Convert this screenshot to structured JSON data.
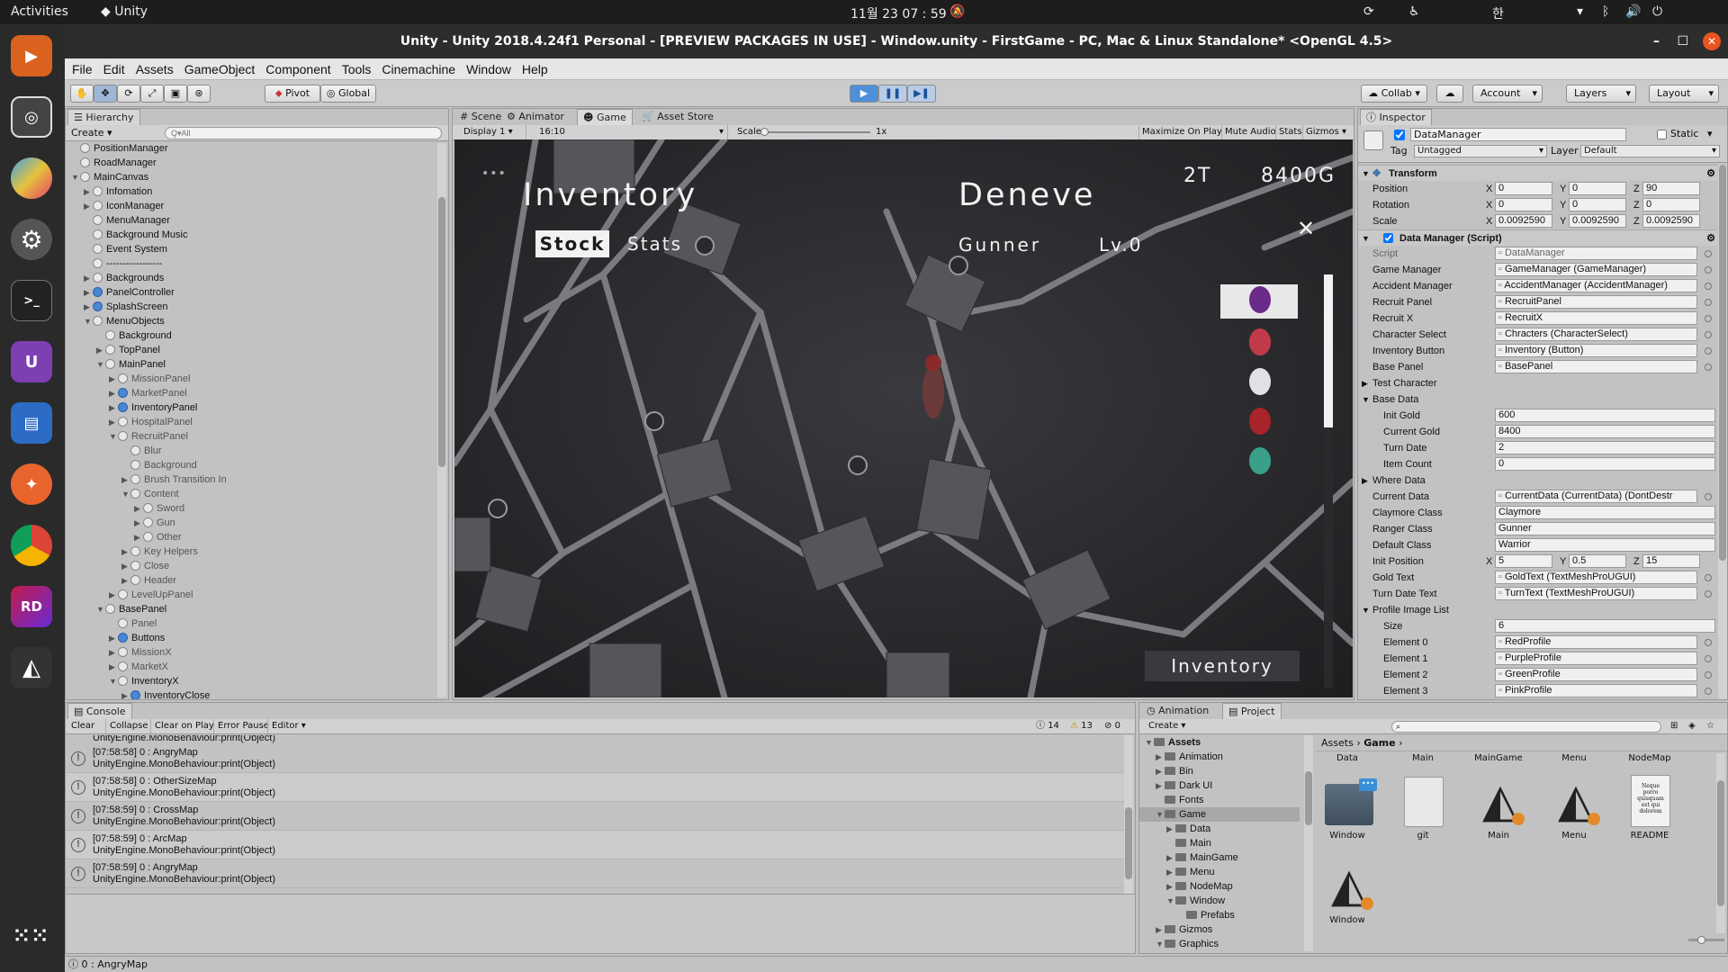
{
  "system": {
    "activities": "Activities",
    "app": "Unity",
    "clock": "11월 23  07 : 59",
    "ime": "한"
  },
  "window": {
    "title": "Unity - Unity 2018.4.24f1 Personal - [PREVIEW PACKAGES IN USE] - Window.unity - FirstGame - PC, Mac & Linux Standalone* <OpenGL 4.5>"
  },
  "menu": [
    "File",
    "Edit",
    "Assets",
    "GameObject",
    "Component",
    "Tools",
    "Cinemachine",
    "Window",
    "Help"
  ],
  "toolbar": {
    "pivot": "Pivot",
    "global": "Global",
    "collab": "Collab",
    "account": "Account",
    "layers": "Layers",
    "layout": "Layout"
  },
  "hierarchy": {
    "tab": "Hierarchy",
    "create": "Create",
    "search_placeholder": "Q▾All",
    "items": [
      {
        "label": "PositionManager",
        "indent": 0,
        "arrow": "",
        "blue": false
      },
      {
        "label": "RoadManager",
        "indent": 0,
        "arrow": "",
        "blue": false
      },
      {
        "label": "MainCanvas",
        "indent": 0,
        "arrow": "▼",
        "blue": false
      },
      {
        "label": "Infomation",
        "indent": 1,
        "arrow": "▶",
        "blue": false
      },
      {
        "label": "IconManager",
        "indent": 1,
        "arrow": "▶",
        "blue": false
      },
      {
        "label": "MenuManager",
        "indent": 1,
        "arrow": "",
        "blue": false
      },
      {
        "label": "Background Music",
        "indent": 1,
        "arrow": "",
        "blue": false
      },
      {
        "label": "Event System",
        "indent": 1,
        "arrow": "",
        "blue": false
      },
      {
        "label": "-----------------",
        "indent": 1,
        "arrow": "",
        "blue": false
      },
      {
        "label": "Backgrounds",
        "indent": 1,
        "arrow": "▶",
        "blue": false
      },
      {
        "label": "PanelController",
        "indent": 1,
        "arrow": "▶",
        "blue": true
      },
      {
        "label": "SplashScreen",
        "indent": 1,
        "arrow": "▶",
        "blue": true
      },
      {
        "label": "MenuObjects",
        "indent": 1,
        "arrow": "▼",
        "blue": false
      },
      {
        "label": "Background",
        "indent": 2,
        "arrow": "",
        "blue": false
      },
      {
        "label": "TopPanel",
        "indent": 2,
        "arrow": "▶",
        "blue": false
      },
      {
        "label": "MainPanel",
        "indent": 2,
        "arrow": "▼",
        "blue": false
      },
      {
        "label": "MissionPanel",
        "indent": 3,
        "arrow": "▶",
        "blue": false,
        "dim": true
      },
      {
        "label": "MarketPanel",
        "indent": 3,
        "arrow": "▶",
        "blue": true,
        "dim": true
      },
      {
        "label": "InventoryPanel",
        "indent": 3,
        "arrow": "▶",
        "blue": true
      },
      {
        "label": "HospitalPanel",
        "indent": 3,
        "arrow": "▶",
        "blue": false,
        "dim": true
      },
      {
        "label": "RecruitPanel",
        "indent": 3,
        "arrow": "▼",
        "blue": false,
        "dim": true
      },
      {
        "label": "Blur",
        "indent": 4,
        "arrow": "",
        "blue": false,
        "dim": true
      },
      {
        "label": "Background",
        "indent": 4,
        "arrow": "",
        "blue": false,
        "dim": true
      },
      {
        "label": "Brush Transition In",
        "indent": 4,
        "arrow": "▶",
        "blue": false,
        "dim": true
      },
      {
        "label": "Content",
        "indent": 4,
        "arrow": "▼",
        "blue": false,
        "dim": true
      },
      {
        "label": "Sword",
        "indent": 5,
        "arrow": "▶",
        "blue": false,
        "dim": true
      },
      {
        "label": "Gun",
        "indent": 5,
        "arrow": "▶",
        "blue": false,
        "dim": true
      },
      {
        "label": "Other",
        "indent": 5,
        "arrow": "▶",
        "blue": false,
        "dim": true
      },
      {
        "label": "Key Helpers",
        "indent": 4,
        "arrow": "▶",
        "blue": false,
        "dim": true
      },
      {
        "label": "Close",
        "indent": 4,
        "arrow": "▶",
        "blue": false,
        "dim": true
      },
      {
        "label": "Header",
        "indent": 4,
        "arrow": "▶",
        "blue": false,
        "dim": true
      },
      {
        "label": "LevelUpPanel",
        "indent": 3,
        "arrow": "▶",
        "blue": false,
        "dim": true
      },
      {
        "label": "BasePanel",
        "indent": 2,
        "arrow": "▼",
        "blue": false
      },
      {
        "label": "Panel",
        "indent": 3,
        "arrow": "",
        "blue": false,
        "dim": true
      },
      {
        "label": "Buttons",
        "indent": 3,
        "arrow": "▶",
        "blue": true
      },
      {
        "label": "MissionX",
        "indent": 3,
        "arrow": "▶",
        "blue": false,
        "dim": true
      },
      {
        "label": "MarketX",
        "indent": 3,
        "arrow": "▶",
        "blue": false,
        "dim": true
      },
      {
        "label": "InventoryX",
        "indent": 3,
        "arrow": "▼",
        "blue": false
      },
      {
        "label": "InventoryClose",
        "indent": 4,
        "arrow": "▶",
        "blue": true
      }
    ]
  },
  "scene_tabs": {
    "scene": "Scene",
    "animator": "Animator",
    "game": "Game",
    "asset_store": "Asset Store"
  },
  "game_bar": {
    "display": "Display 1",
    "aspect": "16:10",
    "scale_label": "Scale",
    "scale_value": "1x",
    "maximize": "Maximize On Play",
    "mute": "Mute Audio",
    "stats": "Stats",
    "gizmos": "Gizmos"
  },
  "game": {
    "dots": "•••",
    "inventory_title": "Inventory",
    "tab_stock": "Stock",
    "tab_stats": "Stats",
    "char_name": "Deneve",
    "char_class": "Gunner",
    "char_level": "Lv.0",
    "turn": "2T",
    "gold": "8400G",
    "close": "✕",
    "inventory_button": "Inventory"
  },
  "inspector": {
    "tab": "Inspector",
    "object_name": "DataManager",
    "static": "Static",
    "tag_label": "Tag",
    "tag_value": "Untagged",
    "layer_label": "Layer",
    "layer_value": "Default",
    "transform": "Transform",
    "position": {
      "label": "Position",
      "x": "0",
      "y": "0",
      "z": "90"
    },
    "rotation": {
      "label": "Rotation",
      "x": "0",
      "y": "0",
      "z": "0"
    },
    "scale": {
      "label": "Scale",
      "x": "0.0092590",
      "y": "0.0092590",
      "z": "0.0092590"
    },
    "script_header": "Data Manager (Script)",
    "fields": [
      {
        "label": "Script",
        "value": "DataManager",
        "dim": true
      },
      {
        "label": "Game Manager",
        "value": "GameManager (GameManager)"
      },
      {
        "label": "Accident Manager",
        "value": "AccidentManager (AccidentManager)"
      },
      {
        "label": "Recruit Panel",
        "value": "RecruitPanel"
      },
      {
        "label": "Recruit X",
        "value": "RecruitX"
      },
      {
        "label": "Character Select",
        "value": "Chracters (CharacterSelect)"
      },
      {
        "label": "Inventory Button",
        "value": "Inventory (Button)"
      },
      {
        "label": "Base Panel",
        "value": "BasePanel"
      }
    ],
    "test_character": "Test Character",
    "base_data": "Base Data",
    "base_fields": [
      {
        "label": "Init Gold",
        "value": "600"
      },
      {
        "label": "Current Gold",
        "value": "8400"
      },
      {
        "label": "Turn Date",
        "value": "2"
      },
      {
        "label": "Item Count",
        "value": "0"
      }
    ],
    "where_data": "Where Data",
    "more_fields": [
      {
        "label": "Current Data",
        "value": "CurrentData (CurrentData) (DontDestr"
      },
      {
        "label": "Claymore Class",
        "value": "Claymore"
      },
      {
        "label": "Ranger Class",
        "value": "Gunner"
      },
      {
        "label": "Default Class",
        "value": "Warrior"
      }
    ],
    "init_position": {
      "label": "Init Position",
      "x": "5",
      "y": "0.5",
      "z": "15"
    },
    "text_fields": [
      {
        "label": "Gold Text",
        "value": "GoldText (TextMeshProUGUI)"
      },
      {
        "label": "Turn Date Text",
        "value": "TurnText (TextMeshProUGUI)"
      }
    ],
    "profile_list": "Profile Image List",
    "size": {
      "label": "Size",
      "value": "6"
    },
    "elements": [
      {
        "label": "Element 0",
        "value": "RedProfile"
      },
      {
        "label": "Element 1",
        "value": "PurpleProfile"
      },
      {
        "label": "Element 2",
        "value": "GreenProfile"
      },
      {
        "label": "Element 3",
        "value": "PinkProfile"
      }
    ]
  },
  "console": {
    "tab": "Console",
    "clear": "Clear",
    "collapse": "Collapse",
    "clear_on_play": "Clear on Play",
    "error_pause": "Error Pause",
    "editor": "Editor",
    "count_info": "14",
    "count_warn": "13",
    "count_err": "0",
    "top_partial": "UnityEngine.MonoBehaviour:print(Object)",
    "logs": [
      {
        "line1": "[07:58:58] 0 : AngryMap",
        "line2": "UnityEngine.MonoBehaviour:print(Object)"
      },
      {
        "line1": "[07:58:58] 0 : OtherSizeMap",
        "line2": "UnityEngine.MonoBehaviour:print(Object)"
      },
      {
        "line1": "[07:58:59] 0 : CrossMap",
        "line2": "UnityEngine.MonoBehaviour:print(Object)"
      },
      {
        "line1": "[07:58:59] 0 : ArcMap",
        "line2": "UnityEngine.MonoBehaviour:print(Object)"
      },
      {
        "line1": "[07:58:59] 0 : AngryMap",
        "line2": "UnityEngine.MonoBehaviour:print(Object)"
      }
    ]
  },
  "project": {
    "tab_animation": "Animation",
    "tab_project": "Project",
    "create": "Create",
    "tree": [
      {
        "label": "Assets",
        "indent": 0,
        "arrow": "▼",
        "bold": true
      },
      {
        "label": "Animation",
        "indent": 1,
        "arrow": "▶"
      },
      {
        "label": "Bin",
        "indent": 1,
        "arrow": "▶"
      },
      {
        "label": "Dark UI",
        "indent": 1,
        "arrow": "▶"
      },
      {
        "label": "Fonts",
        "indent": 1,
        "arrow": ""
      },
      {
        "label": "Game",
        "indent": 1,
        "arrow": "▼",
        "selected": true
      },
      {
        "label": "Data",
        "indent": 2,
        "arrow": "▶"
      },
      {
        "label": "Main",
        "indent": 2,
        "arrow": ""
      },
      {
        "label": "MainGame",
        "indent": 2,
        "arrow": "▶"
      },
      {
        "label": "Menu",
        "indent": 2,
        "arrow": "▶"
      },
      {
        "label": "NodeMap",
        "indent": 2,
        "arrow": "▶"
      },
      {
        "label": "Window",
        "indent": 2,
        "arrow": "▼"
      },
      {
        "label": "Prefabs",
        "indent": 3,
        "arrow": ""
      },
      {
        "label": "Gizmos",
        "indent": 1,
        "arrow": "▶"
      },
      {
        "label": "Graphics",
        "indent": 1,
        "arrow": "▼"
      }
    ],
    "breadcrumb": [
      "Assets",
      "Game"
    ],
    "headers": [
      "Data",
      "Main",
      "MainGame",
      "Menu",
      "NodeMap"
    ],
    "assets": [
      {
        "name": "Window",
        "kind": "folder"
      },
      {
        "name": "git",
        "kind": "file"
      },
      {
        "name": "Main",
        "kind": "unity"
      },
      {
        "name": "Menu",
        "kind": "unity"
      },
      {
        "name": "README",
        "kind": "doc"
      },
      {
        "name": "Window",
        "kind": "unity"
      }
    ],
    "readme_preview": "Neque porro quisquam est qui dolorem"
  },
  "status": {
    "message": "0 : AngryMap"
  }
}
